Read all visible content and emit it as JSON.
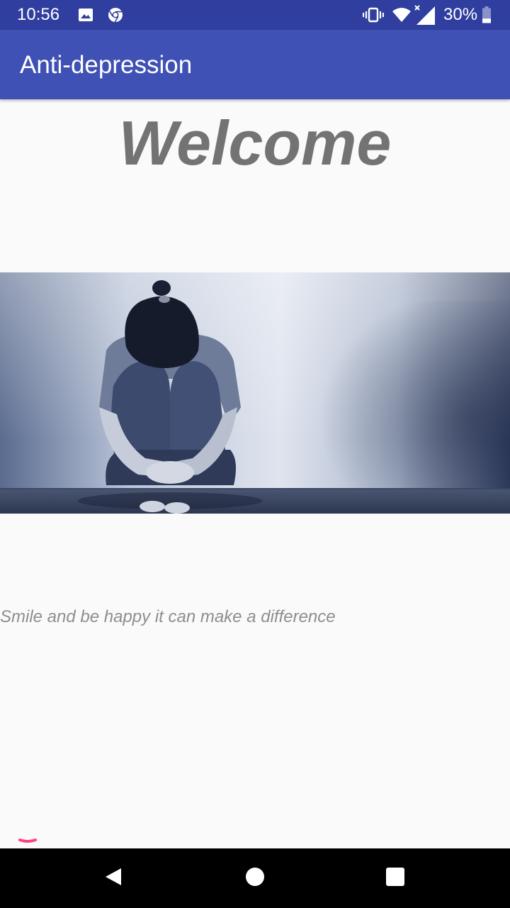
{
  "status_bar": {
    "time": "10:56",
    "battery_percent": "30%",
    "icons": [
      "image-icon",
      "chrome-icon",
      "vibrate-icon",
      "wifi-icon",
      "cell-signal-icon",
      "battery-icon"
    ],
    "battery_level": 0.3
  },
  "app_bar": {
    "title": "Anti-depression",
    "background": "#3f51b5"
  },
  "main": {
    "heading": "Welcome",
    "tagline": "Smile and be happy it can make a difference",
    "hero_image": "sad-woman-image"
  },
  "colors": {
    "status_bar": "#303f9f",
    "accent": "#ff4081",
    "heading": "#737373"
  },
  "nav_bar": {
    "buttons": [
      "back-icon",
      "home-icon",
      "recents-icon"
    ]
  }
}
